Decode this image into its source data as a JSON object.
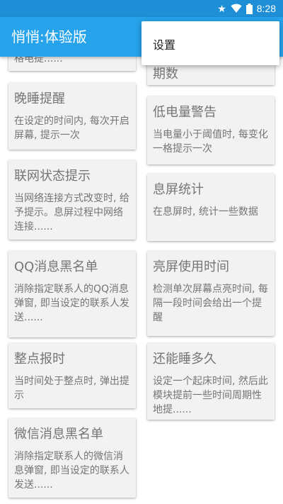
{
  "status_bar": {
    "time": "8:28",
    "icons": [
      "star-icon",
      "wifi-icon",
      "battery-icon"
    ]
  },
  "app_bar": {
    "title": "悄悄:体验版"
  },
  "overflow_menu": {
    "items": [
      {
        "label": "设置"
      }
    ]
  },
  "colors": {
    "status_bar": "#1e8fd6",
    "app_bar": "#27a3ec",
    "card": "#f2f2f2",
    "text": "#757575"
  },
  "left_cards": [
    {
      "title": "",
      "desc": "格电提......"
    },
    {
      "title": "晚睡提醒",
      "desc": "在设定的时间内, 每次开启屏幕, 提示一次"
    },
    {
      "title": "联网状态提示",
      "desc": "当网络连接方式改变时, 给予提示。息屏过程中网络连接......"
    },
    {
      "title": "QQ消息黑名单",
      "desc": "消除指定联系人的QQ消息弹窗, 即当设定的联系人发送......"
    },
    {
      "title": "整点报时",
      "desc": "当时间处于整点时, 弹出提示"
    },
    {
      "title": "微信消息黑名单",
      "desc": "消除指定联系人的微信消息弹窗, 即当设定的联系人发送......"
    }
  ],
  "right_cards": [
    {
      "title": "期数",
      "desc": ""
    },
    {
      "title": "低电量警告",
      "desc": "当电量小于阈值时, 每变化一格提示一次"
    },
    {
      "title": "息屏统计",
      "desc": "在息屏时, 统计一些数据"
    },
    {
      "title": "亮屏使用时间",
      "desc": "检测单次屏幕点亮时间, 每隔一段时间会给出一个提醒"
    },
    {
      "title": "还能睡多久",
      "desc": "设定一个起床时间, 然后此模块提前一些时间周期性地提......"
    }
  ]
}
